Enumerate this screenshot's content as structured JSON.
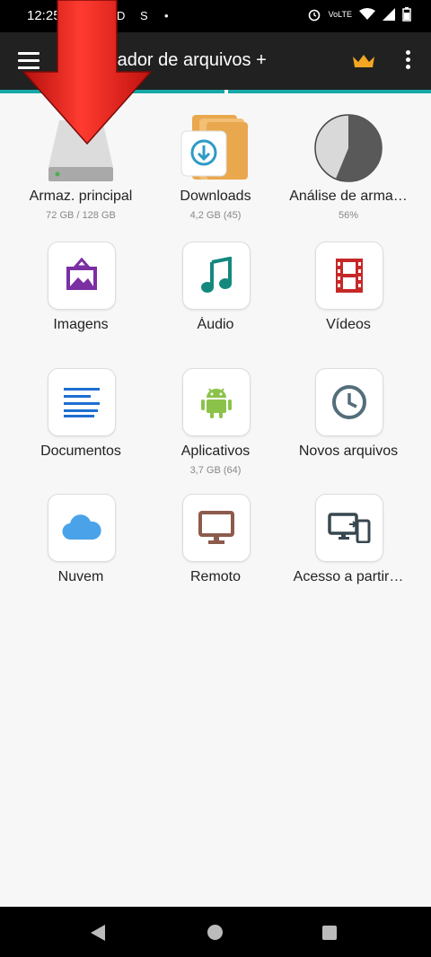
{
  "status_bar": {
    "time": "12:25",
    "notif_a": "D",
    "notif_b": "S",
    "network": "VoLTE"
  },
  "app_bar": {
    "title": "nciador de arquivos +"
  },
  "colors": {
    "accent": "#18a7a7",
    "arrow": "#e8231f",
    "crown": "#f5a623"
  },
  "items": [
    {
      "id": "main-storage",
      "label": "Armaz. principal",
      "sub": "72 GB / 128 GB",
      "icon": "hard-drive-icon"
    },
    {
      "id": "downloads",
      "label": "Downloads",
      "sub": "4,2 GB (45)",
      "icon": "downloads-folder-icon"
    },
    {
      "id": "storage-analysis",
      "label": "Análise de arma…",
      "sub": "56%",
      "icon": "pie-chart-icon"
    },
    {
      "id": "images",
      "label": "Imagens",
      "sub": "",
      "icon": "image-icon"
    },
    {
      "id": "audio",
      "label": "Áudio",
      "sub": "",
      "icon": "music-note-icon"
    },
    {
      "id": "videos",
      "label": "Vídeos",
      "sub": "",
      "icon": "film-icon"
    },
    {
      "id": "documents",
      "label": "Documentos",
      "sub": "",
      "icon": "document-lines-icon"
    },
    {
      "id": "apps",
      "label": "Aplicativos",
      "sub": "3,7 GB (64)",
      "icon": "android-icon"
    },
    {
      "id": "recent-files",
      "label": "Novos arquivos",
      "sub": "",
      "icon": "clock-icon"
    },
    {
      "id": "cloud",
      "label": "Nuvem",
      "sub": "",
      "icon": "cloud-icon"
    },
    {
      "id": "remote",
      "label": "Remoto",
      "sub": "",
      "icon": "monitor-icon"
    },
    {
      "id": "access-from",
      "label": "Acesso a partir…",
      "sub": "",
      "icon": "devices-icon"
    }
  ]
}
